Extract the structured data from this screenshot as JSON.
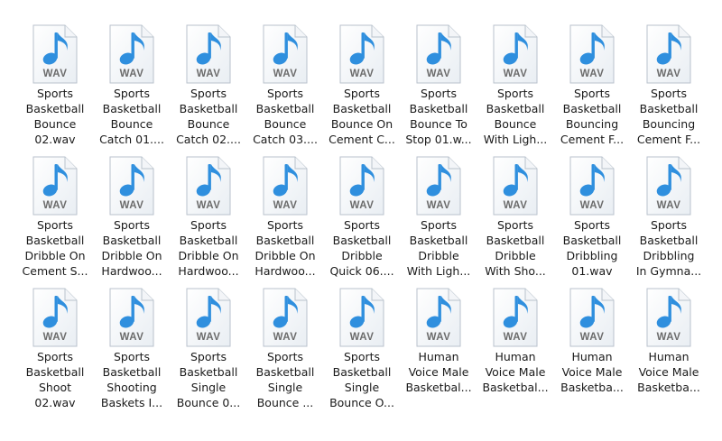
{
  "window": {
    "view": "large-icons"
  },
  "icon": {
    "name": "wav-audio-file-icon",
    "badge_text": "WAV",
    "note_color": "#2f8fde",
    "badge_color": "#6b6b6b"
  },
  "files": [
    {
      "label": "Sports\nBasketball\nBounce\n02.wav"
    },
    {
      "label": "Sports\nBasketball\nBounce\nCatch 01...."
    },
    {
      "label": "Sports\nBasketball\nBounce\nCatch 02...."
    },
    {
      "label": "Sports\nBasketball\nBounce\nCatch 03...."
    },
    {
      "label": "Sports\nBasketball\nBounce On\nCement C..."
    },
    {
      "label": "Sports\nBasketball\nBounce To\nStop 01.w..."
    },
    {
      "label": "Sports\nBasketball\nBounce\nWith Ligh..."
    },
    {
      "label": "Sports\nBasketball\nBouncing\nCement F..."
    },
    {
      "label": "Sports\nBasketball\nBouncing\nCement F..."
    },
    {
      "label": "Sports\nBasketball\nDribble On\nCement S..."
    },
    {
      "label": "Sports\nBasketball\nDribble On\nHardwoo..."
    },
    {
      "label": "Sports\nBasketball\nDribble On\nHardwoo..."
    },
    {
      "label": "Sports\nBasketball\nDribble On\nHardwoo..."
    },
    {
      "label": "Sports\nBasketball\nDribble\nQuick 06...."
    },
    {
      "label": "Sports\nBasketball\nDribble\nWith Ligh..."
    },
    {
      "label": "Sports\nBasketball\nDribble\nWith Sho..."
    },
    {
      "label": "Sports\nBasketball\nDribbling\n01.wav"
    },
    {
      "label": "Sports\nBasketball\nDribbling\nIn Gymna..."
    },
    {
      "label": "Sports\nBasketball\nShoot\n02.wav"
    },
    {
      "label": "Sports\nBasketball\nShooting\nBaskets I..."
    },
    {
      "label": "Sports\nBasketball\nSingle\nBounce 0..."
    },
    {
      "label": "Sports\nBasketball\nSingle\nBounce ..."
    },
    {
      "label": "Sports\nBasketball\nSingle\nBounce O..."
    },
    {
      "label": "Human\nVoice Male\nBasketbal..."
    },
    {
      "label": "Human\nVoice Male\nBasketbal..."
    },
    {
      "label": "Human\nVoice Male\nBasketba..."
    },
    {
      "label": "Human\nVoice Male\nBasketba..."
    }
  ]
}
